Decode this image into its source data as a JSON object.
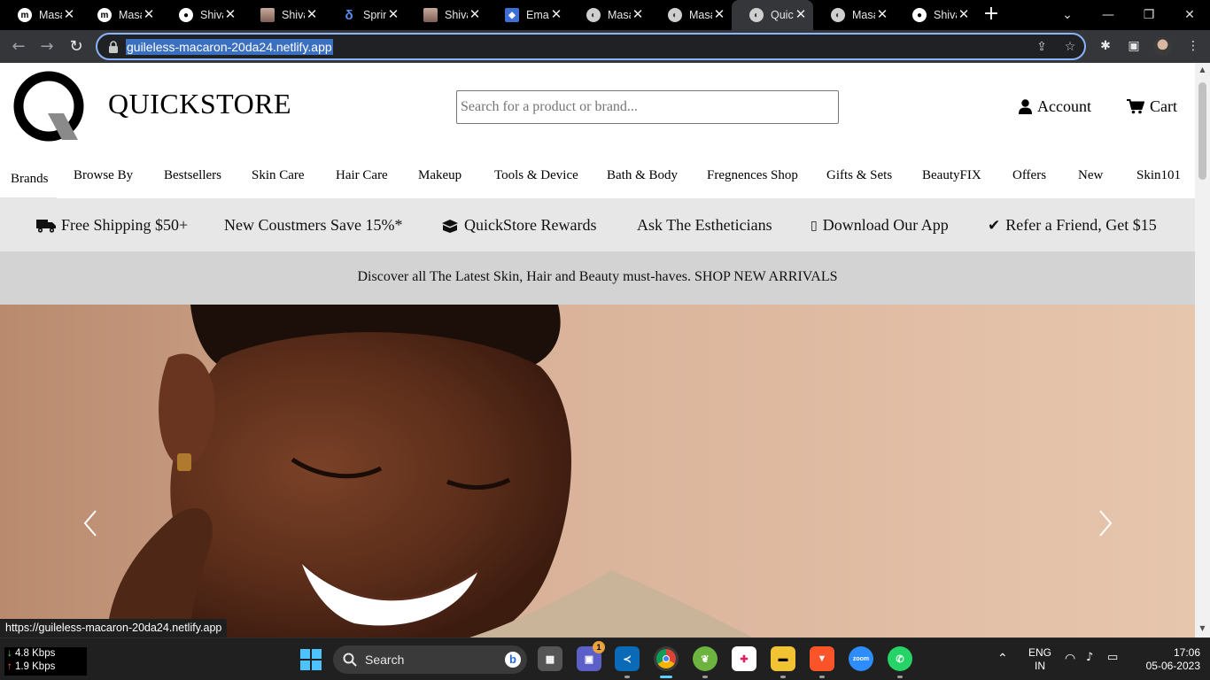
{
  "browser": {
    "tabs": [
      {
        "icon": "masai-m-icon",
        "title": "Masai School"
      },
      {
        "icon": "masai-m-icon",
        "title": "Masai School"
      },
      {
        "icon": "github-icon",
        "title": "Shiva"
      },
      {
        "icon": "profile-photo-icon",
        "title": "Shiva"
      },
      {
        "icon": "spring-icon",
        "title": "Spring"
      },
      {
        "icon": "profile-photo-icon",
        "title": "Shiva"
      },
      {
        "icon": "email-icon",
        "title": "Email"
      },
      {
        "icon": "globe-icon",
        "title": "Masai"
      },
      {
        "icon": "globe-icon",
        "title": "Masai"
      },
      {
        "icon": "globe-icon",
        "title": "QuickStore"
      },
      {
        "icon": "globe-icon",
        "title": "Masai"
      },
      {
        "icon": "github-icon",
        "title": "Shiva"
      }
    ],
    "active_tab_index": 9,
    "url": "guileless-macaron-20da24.netlify.app",
    "status_url": "https://guileless-macaron-20da24.netlify.app"
  },
  "site": {
    "brand": "QUICKSTORE",
    "search_placeholder": "Search for a product or brand...",
    "account_label": "Account",
    "cart_label": "Cart",
    "menu": [
      "Brands",
      "Browse By",
      "Bestsellers",
      "Skin Care",
      "Hair Care",
      "Makeup",
      "Tools & Device",
      "Bath & Body",
      "Fregnences Shop",
      "Gifts & Sets",
      "BeautyFIX",
      "Offers",
      "New",
      "Skin101"
    ],
    "perks": [
      {
        "icon": "truck-icon",
        "label": "Free Shipping $50+"
      },
      {
        "icon": "",
        "label": "New Coustmers Save 15%*"
      },
      {
        "icon": "gift-box-icon",
        "label": "QuickStore Rewards"
      },
      {
        "icon": "",
        "label": "Ask The Estheticians"
      },
      {
        "icon": "mobile-phone-icon",
        "label": "Download Our App"
      },
      {
        "icon": "check-icon",
        "label": "Refer a Friend, Get $15"
      }
    ],
    "announcement": "Discover all The Latest Skin, Hair and Beauty must-haves. SHOP NEW ARRIVALS",
    "hero": {
      "image": "smiling-woman-closeup-photo"
    }
  },
  "taskbar": {
    "net_down": "4.8 Kbps",
    "net_up": "1.9 Kbps",
    "search_label": "Search",
    "teams_badge": "1",
    "apps": [
      "file-explorer-icon",
      "teams-icon",
      "vscode-icon",
      "chrome-icon",
      "spring-tool-icon",
      "slack-icon",
      "folder-icon",
      "brave-icon",
      "zoom-icon",
      "whatsapp-icon"
    ],
    "lang": "ENG",
    "region": "IN",
    "time": "17:06",
    "date": "05-06-2023"
  },
  "colors": {
    "chrome_dark": "#35363a",
    "perk_bar": "#e7e7e7",
    "announce_bar": "#d3d3d3",
    "omnibox_focus": "#8ab4f8"
  }
}
